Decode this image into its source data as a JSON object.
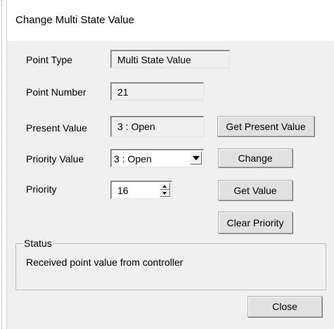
{
  "window": {
    "title": "Change Multi State Value"
  },
  "form": {
    "point_type": {
      "label": "Point Type",
      "value": "Multi State Value"
    },
    "point_number": {
      "label": "Point Number",
      "value": "21"
    },
    "present_value": {
      "label": "Present Value",
      "value": "3 : Open"
    },
    "priority_value": {
      "label": "Priority Value",
      "selected": "3 : Open"
    },
    "priority": {
      "label": "Priority",
      "value": "16"
    }
  },
  "buttons": {
    "get_present_value": "Get Present Value",
    "change": "Change",
    "get_value": "Get Value",
    "clear_priority": "Clear Priority",
    "close": "Close"
  },
  "status": {
    "legend": "Status",
    "message": "Received point value from controller"
  },
  "icons": {
    "dropdown": "chevron-down-icon",
    "spin_up": "arrow-up-icon",
    "spin_down": "arrow-down-icon"
  }
}
